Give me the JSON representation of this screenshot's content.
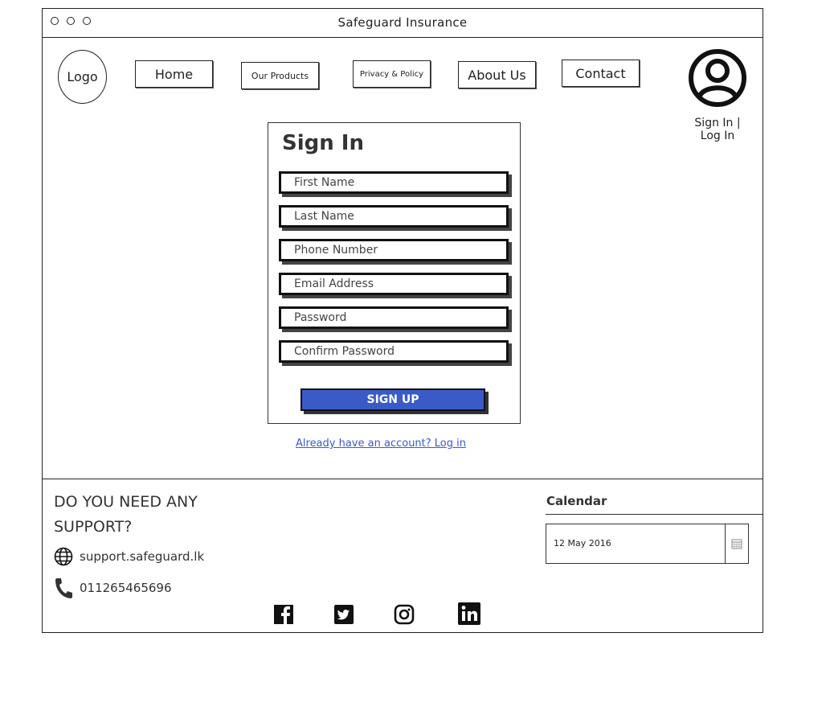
{
  "window": {
    "title": "Safeguard Insurance",
    "controls": [
      "window-dot-1",
      "window-dot-2",
      "window-dot-3"
    ]
  },
  "header": {
    "logo_label": "Logo",
    "nav": {
      "home": "Home",
      "products": "Our Products",
      "privacy": "Privacy & Policy",
      "about": "About Us",
      "contact": "Contact"
    },
    "account": {
      "icon": "user-circle-icon",
      "label_line1": "Sign In |",
      "label_line2": "Log In"
    }
  },
  "form": {
    "title": "Sign In",
    "fields": {
      "first_name": "First Name",
      "last_name": "Last Name",
      "phone": "Phone Number",
      "email": "Email Address",
      "password": "Password",
      "confirm_password": "Confirm Password"
    },
    "submit_label": "SIGN UP",
    "submit_color": "#3a5bc7",
    "login_link": "Already have an account? Log in"
  },
  "footer": {
    "support_title_line1": "DO YOU NEED ANY",
    "support_title_line2": "SUPPORT?",
    "website": "support.safeguard.lk",
    "phone": "011265465696",
    "social_icons": [
      "facebook-icon",
      "twitter-icon",
      "instagram-icon",
      "linkedin-icon"
    ],
    "calendar": {
      "label": "Calendar",
      "value": "12 May 2016",
      "icon": "calendar-icon"
    }
  }
}
